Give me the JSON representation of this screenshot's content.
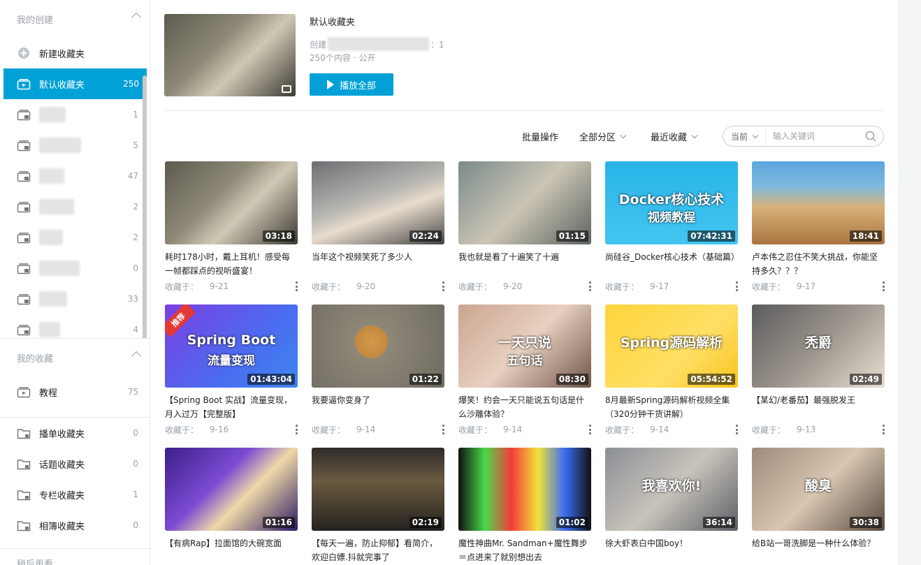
{
  "sidebar": {
    "my_created": "我的创建",
    "new_folder": "新建收藏夹",
    "default_folder": {
      "label": "默认收藏夹",
      "count": "250"
    },
    "hidden_folders": [
      {
        "count": "1",
        "blur_w": 38
      },
      {
        "count": "5",
        "blur_w": 60
      },
      {
        "count": "47",
        "blur_w": 36
      },
      {
        "count": "2",
        "blur_w": 50
      },
      {
        "count": "2",
        "blur_w": 34
      },
      {
        "count": "0",
        "blur_w": 58
      },
      {
        "count": "33",
        "blur_w": 40
      },
      {
        "count": "4",
        "blur_w": 30
      }
    ],
    "my_collect": "我的收藏",
    "tutorial": {
      "label": "教程",
      "count": "75"
    },
    "other_folders": [
      {
        "label": "播单收藏夹",
        "count": "0"
      },
      {
        "label": "话题收藏夹",
        "count": "0"
      },
      {
        "label": "专栏收藏夹",
        "count": "1"
      },
      {
        "label": "相簿收藏夹",
        "count": "0"
      }
    ],
    "watch_later": "稍后再看"
  },
  "folder": {
    "title": "默认收藏夹",
    "creator_prefix": "创建",
    "play_count_suffix": "：1",
    "meta": "250个内容 · 公开",
    "play_all": "播放全部"
  },
  "toolbar": {
    "batch": "批量操作",
    "all_zones": "全部分区",
    "recent": "最近收藏",
    "scope": "当前",
    "search_placeholder": "输入关键词"
  },
  "videos": [
    {
      "title": "耗时178小时，戴上耳机！感受每一帧都踩点的视听盛宴！",
      "dur": "03:18",
      "date": "9-21",
      "bg": "linear-gradient(135deg,#5c5a4f,#8f8a78 40%,#cfc8b4 60%,#3c3a33)"
    },
    {
      "title": "当年这个视频笑死了多少人",
      "dur": "02:24",
      "bg": "linear-gradient(160deg,#6e6e73,#b9b7b2 45%,#e8dccd 60%,#444)",
      "date": "9-20"
    },
    {
      "title": "我也就是看了十遍笑了十遍",
      "dur": "01:15",
      "bg": "linear-gradient(135deg,#7a8a8a,#cbc5b5 50%,#5d6561)",
      "date": "9-20"
    },
    {
      "title": "尚硅谷_Docker核心技术（基础篇）",
      "dur": "07:42:31",
      "bg": "linear-gradient(180deg,#29b4e8,#43c5f0)",
      "date": "9-17",
      "overlay": "Docker核心技术",
      "overlay2": "视频教程"
    },
    {
      "title": "卢本伟之忍住不笑大挑战，你能坚持多久？？？",
      "dur": "18:41",
      "bg": "linear-gradient(180deg,#5aa6de 0%,#7fb9dd 30%,#d8b27a 55%,#a9743f 100%)",
      "date": "9-17"
    },
    {
      "title": "【Spring Boot 实战】流量变现，月入过万【完整版】",
      "dur": "01:43:04",
      "bg": "linear-gradient(135deg,#7b3fe0,#4b6cf0 60%,#3d86ee)",
      "date": "9-16",
      "overlay": "Spring Boot",
      "overlay2": "流量变现",
      "badge": "推荐"
    },
    {
      "title": "我要逼你变身了",
      "dur": "01:22",
      "bg": "radial-gradient(circle at 45% 45%,#d49a4c 0,#c38a3e 18%,#8d8778 20%,#6e6a60 100%)",
      "date": "9-14"
    },
    {
      "title": "爆笑！约会一天只能说五句话是什么沙雕体验？",
      "dur": "08:30",
      "bg": "linear-gradient(135deg,#caa590,#e8d0c0 50%,#6d5448)",
      "date": "9-14",
      "overlay": "一天只说",
      "overlay2": "五句话"
    },
    {
      "title": "8月最新Spring源码解析视频全集（320分钟干货讲解）",
      "dur": "05:54:52",
      "bg": "linear-gradient(135deg,#ffd43b,#ffe066 60%,#f8c21c)",
      "date": "9-14",
      "overlay": "Spring源码解析"
    },
    {
      "title": "【某幻/老番茄】最强脱发王",
      "dur": "02:49",
      "bg": "linear-gradient(135deg,#5b5b5b,#9b948c 50%,#e9e0d2)",
      "date": "9-13",
      "overlay": "秃爵"
    },
    {
      "title": "【有病Rap】拉面馆的大碗宽面",
      "dur": "01:16",
      "bg": "linear-gradient(135deg,#3d1e8a,#7b4bd2 40%,#efd9a8 60%,#2c1963)"
    },
    {
      "title": "【每天一遍，防止抑郁】看简介，欢迎白嫖.抖就完事了",
      "dur": "02:19",
      "bg": "linear-gradient(180deg,#2e2b2a,#6a5a40 40%,#25221f)"
    },
    {
      "title": "魔性神曲Mr. Sandman+魔性舞步＝点进来了就别想出去",
      "dur": "01:02",
      "bg": "linear-gradient(90deg,#111 0%,#4ad94a 20%,#f23b3b 40%,#f2e33b 60%,#3b6df2 80%,#111 100%)"
    },
    {
      "title": "徐大虾表白中国boy！",
      "dur": "36:14",
      "bg": "linear-gradient(135deg,#8a8e96,#c9c4bb 50%,#5c5f66)",
      "overlay": "我喜欢你!"
    },
    {
      "title": "给B站一哥洗脚是一种什么体验？",
      "dur": "30:38",
      "bg": "linear-gradient(135deg,#9d8a79,#d8c6b2 50%,#5a4a3e)",
      "overlay": "酸臭"
    }
  ],
  "collected_prefix": "收藏于："
}
